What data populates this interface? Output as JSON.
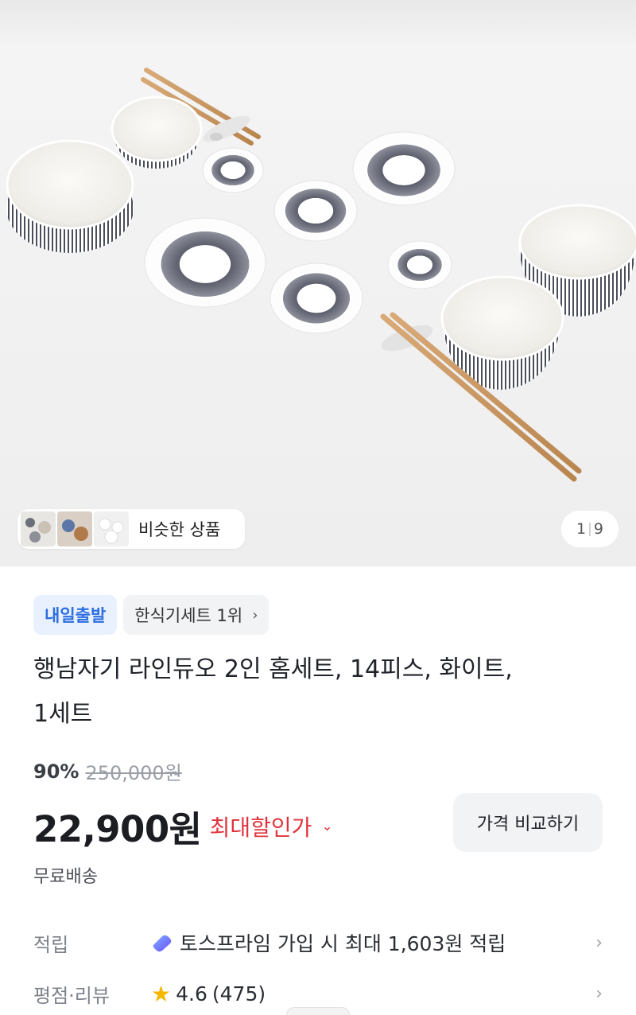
{
  "gallery": {
    "similar_label": "비슷한 상품",
    "page_current": "1",
    "page_total": "9",
    "similar_thumbs": [
      "thumb-1",
      "thumb-2",
      "thumb-3"
    ]
  },
  "badges": {
    "delivery": "내일출발",
    "rank": "한식기세트 1위"
  },
  "product": {
    "title_line1": "행남자기 라인듀오 2인 홈세트, 14피스, 화이트,",
    "title_line2": "1세트"
  },
  "pricing": {
    "discount_rate": "90%",
    "original_price": "250,000원",
    "sale_price": "22,900원",
    "max_discount_label": "최대할인가",
    "compare_button": "가격 비교하기",
    "shipping": "무료배송"
  },
  "points": {
    "label": "적립",
    "text": "토스프라임 가입 시 최대 1,603원 적립"
  },
  "reviews": {
    "label": "평점·리뷰",
    "rating": "4.6",
    "count": "(475)"
  },
  "colors": {
    "accent_blue": "#2c6ee0",
    "discount_red": "#e0343d",
    "star": "#f5b800"
  }
}
